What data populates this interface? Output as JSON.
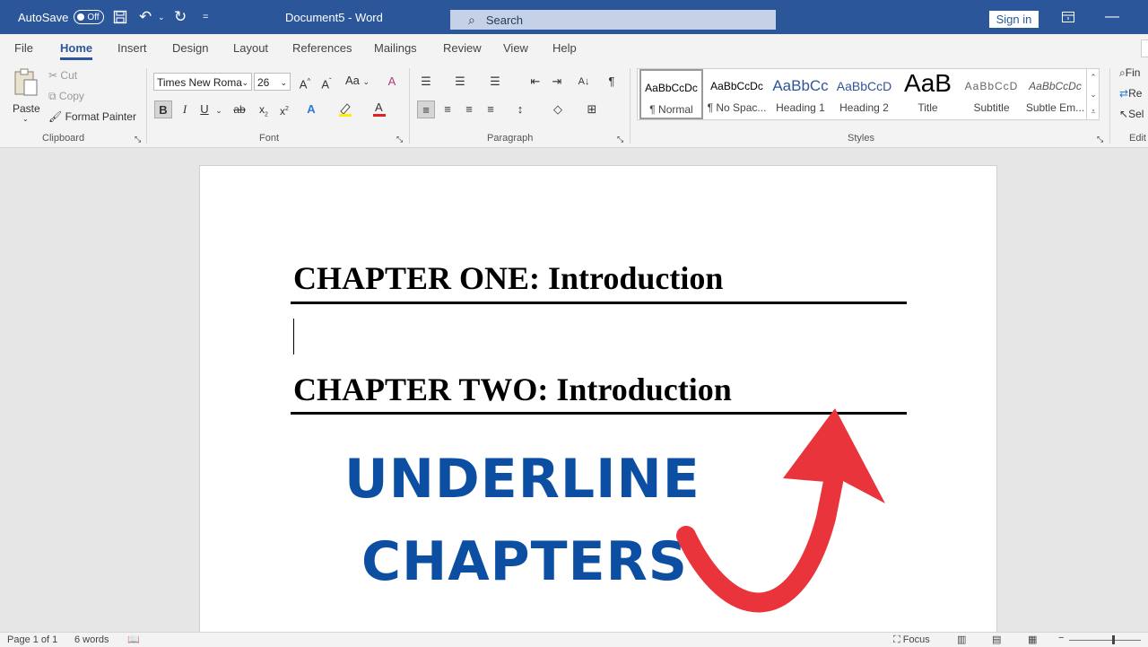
{
  "titlebar": {
    "autosave_label": "AutoSave",
    "autosave_state": "Off",
    "document_title": "Document5 - Word",
    "search_placeholder": "Search",
    "sign_in": "Sign in"
  },
  "tabs": [
    "File",
    "Home",
    "Insert",
    "Design",
    "Layout",
    "References",
    "Mailings",
    "Review",
    "View",
    "Help"
  ],
  "active_tab": "Home",
  "ribbon": {
    "clipboard": {
      "paste": "Paste",
      "cut": "Cut",
      "copy": "Copy",
      "format_painter": "Format Painter",
      "label": "Clipboard"
    },
    "font": {
      "name": "Times New Roma",
      "size": "26",
      "label": "Font",
      "aa_label": "Aa"
    },
    "paragraph": {
      "label": "Paragraph"
    },
    "styles": {
      "label": "Styles",
      "items": [
        {
          "preview": "AaBbCcDc",
          "name": "¶ Normal"
        },
        {
          "preview": "AaBbCcDc",
          "name": "¶ No Spac..."
        },
        {
          "preview": "AaBbCc",
          "name": "Heading 1"
        },
        {
          "preview": "AaBbCcD",
          "name": "Heading 2"
        },
        {
          "preview": "AaB",
          "name": "Title"
        },
        {
          "preview": "AaBbCcD",
          "name": "Subtitle"
        },
        {
          "preview": "AaBbCcDc",
          "name": "Subtle Em..."
        }
      ]
    },
    "editing": {
      "find": "Fin",
      "replace": "Re",
      "select": "Sel",
      "label": "Edit"
    }
  },
  "document": {
    "chapter_one": "CHAPTER ONE: Introduction",
    "chapter_two": "CHAPTER TWO: Introduction"
  },
  "overlay": {
    "line1": "UNDERLINE",
    "line2": "CHAPTERS",
    "text_color": "#0b4ea2",
    "arrow_color": "#e8343a"
  },
  "status": {
    "page": "Page 1 of 1",
    "words": "6 words",
    "focus": "Focus"
  }
}
